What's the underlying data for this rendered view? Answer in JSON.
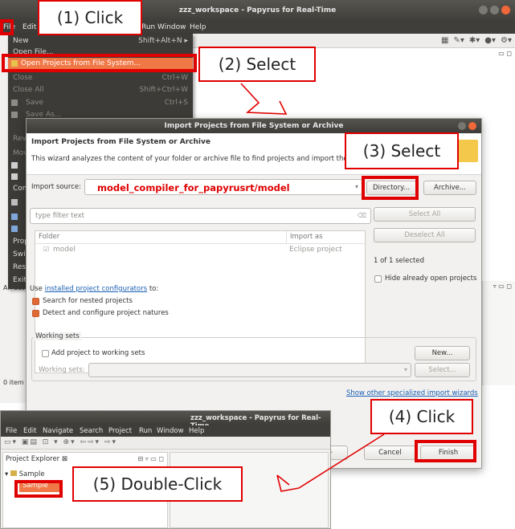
{
  "main_window": {
    "title": "zzz_workspace - Papyrus for Real-Time",
    "menus": [
      "File",
      "Edit",
      "Run",
      "Window",
      "Help"
    ]
  },
  "file_menu": {
    "items": [
      {
        "label": "New",
        "shortcut": "Shift+Alt+N ▸",
        "disabled": false,
        "highlight": false
      },
      {
        "label": "Open File...",
        "shortcut": "",
        "disabled": false,
        "highlight": false
      },
      {
        "label": "Open Projects from File System...",
        "shortcut": "",
        "disabled": false,
        "highlight": true
      },
      {
        "label": "Close",
        "shortcut": "Ctrl+W",
        "disabled": true,
        "highlight": false
      },
      {
        "label": "Close All",
        "shortcut": "Shift+Ctrl+W",
        "disabled": true,
        "highlight": false
      },
      {
        "label": "Save",
        "shortcut": "Ctrl+S",
        "disabled": true,
        "highlight": false
      },
      {
        "label": "Save As...",
        "shortcut": "",
        "disabled": true,
        "highlight": false
      }
    ],
    "partial_labels": [
      "Rev",
      "Mov",
      "",
      "",
      "Con",
      "",
      "",
      "",
      "Prop",
      "Swit",
      "Rest",
      "Exit"
    ]
  },
  "left_bottom": {
    "outline_label": "An out",
    "items_label": "0 item"
  },
  "dialog": {
    "title": "Import Projects from File System or Archive",
    "heading": "Import Projects from File System or Archive",
    "description": "This wizard analyzes the content of your folder or archive file to find projects and import them",
    "import_source_label": "Import source:",
    "import_source_value": "model_compiler_for_papyrusrt/model",
    "directory_button": "Directory...",
    "archive_button": "Archive...",
    "filter_placeholder": "type filter text",
    "select_all": "Select All",
    "deselect_all": "Deselect All",
    "table_headers": [
      "Folder",
      "Import as"
    ],
    "table_rows": [
      {
        "folder": "model",
        "import_as": "Eclipse project"
      }
    ],
    "selected_count": "1 of 1 selected",
    "hide_open_label": "Hide already open projects",
    "use_label": "Use",
    "configurators_link": "installed project configurators",
    "configurators_to": "to:",
    "search_nested": "Search for nested projects",
    "detect_configure": "Detect and configure project natures",
    "working_sets_group": "Working sets",
    "add_to_working_sets": "Add project to working sets",
    "new_button": "New...",
    "working_sets_label": "Working sets:",
    "select_button": "Select...",
    "show_other_link": "Show other specialized import wizards",
    "next_button": "t >",
    "cancel_button": "Cancel",
    "finish_button": "Finish"
  },
  "second_window": {
    "title": "zzz_workspace - Papyrus for Real-Time",
    "menus": [
      "File",
      "Edit",
      "Navigate",
      "Search",
      "Project",
      "Run",
      "Window",
      "Help"
    ],
    "project_explorer_tab": "Project Explorer ⊠",
    "tree_root": "Sample",
    "tree_item": "Sample"
  },
  "annotations": {
    "step1": "(1) Click",
    "step2": "(2) Select",
    "step3": "(3) Select",
    "step4": "(4) Click",
    "step5": "(5) Double-Click"
  },
  "colors": {
    "annotation_red": "#e00000",
    "ubuntu_orange": "#f07746",
    "link_blue": "#1a5fb4"
  }
}
